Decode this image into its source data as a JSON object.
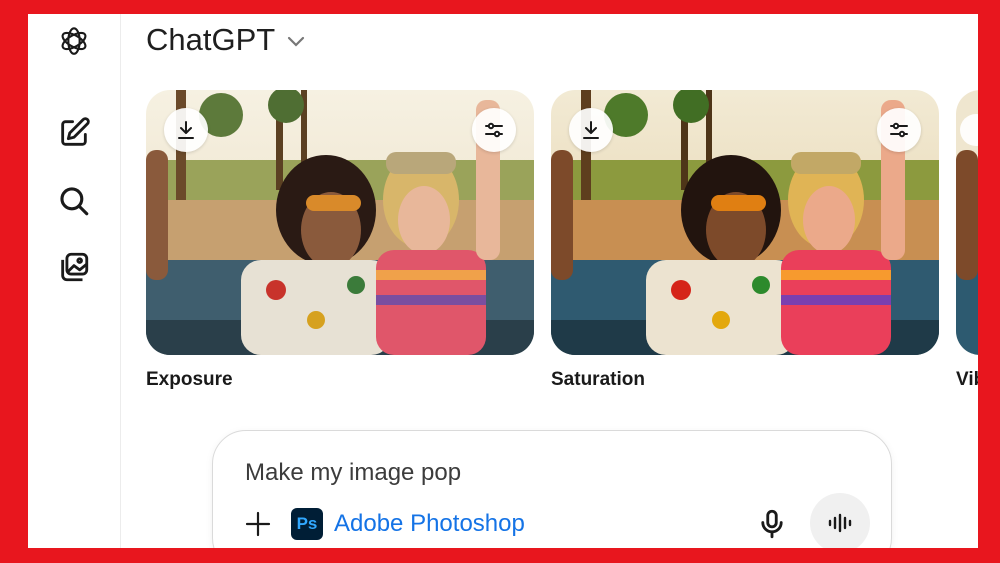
{
  "header": {
    "title": "ChatGPT"
  },
  "sidebar": {
    "items": [
      {
        "name": "new-chat",
        "icon": "compose-icon"
      },
      {
        "name": "search",
        "icon": "search-icon"
      },
      {
        "name": "images",
        "icon": "image-gallery-icon"
      }
    ]
  },
  "cards": [
    {
      "label": "Exposure",
      "download_icon": "download-icon",
      "adjust_icon": "sliders-icon"
    },
    {
      "label": "Saturation",
      "download_icon": "download-icon",
      "adjust_icon": "sliders-icon"
    },
    {
      "label": "Vib"
    }
  ],
  "composer": {
    "prompt": "Make my image pop",
    "app_badge": "Ps",
    "app_name": "Adobe Photoshop"
  },
  "colors": {
    "frame": "#e8161e",
    "app_link": "#1473e6",
    "ps_bg": "#001e36",
    "ps_fg": "#31a8ff"
  }
}
